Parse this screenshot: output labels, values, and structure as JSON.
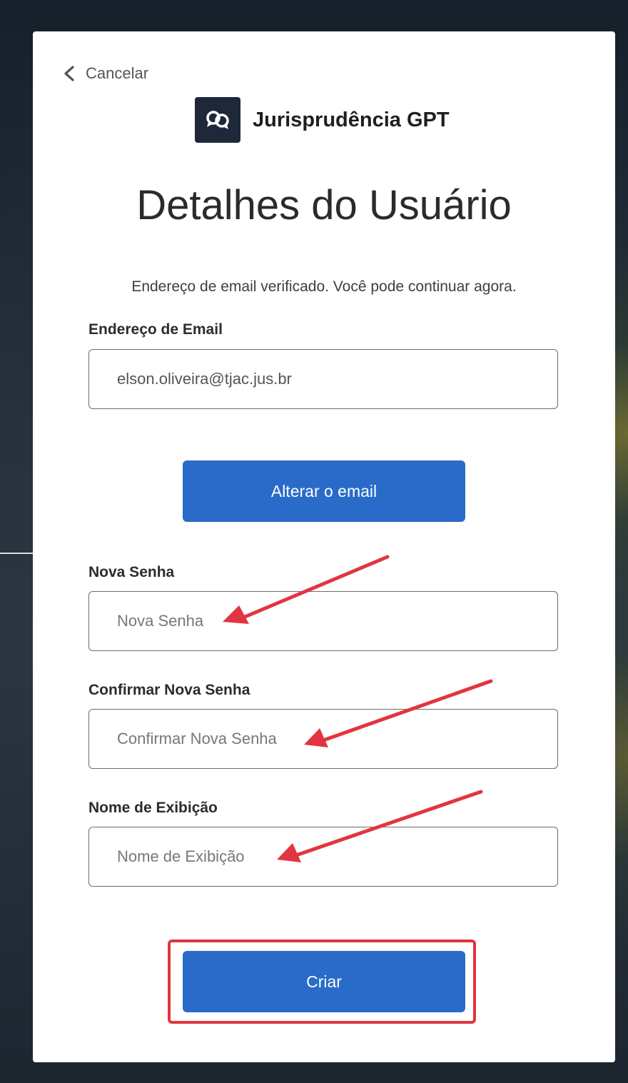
{
  "back": {
    "label": "Cancelar"
  },
  "brand": {
    "name": "Jurisprudência GPT"
  },
  "page": {
    "title": "Detalhes do Usuário",
    "subtitle": "Endereço de email verificado. Você pode continuar agora."
  },
  "form": {
    "email": {
      "label": "Endereço de Email",
      "value": "elson.oliveira@tjac.jus.br"
    },
    "change_email_label": "Alterar o email",
    "new_password": {
      "label": "Nova Senha",
      "placeholder": "Nova Senha"
    },
    "confirm_password": {
      "label": "Confirmar Nova Senha",
      "placeholder": "Confirmar Nova Senha"
    },
    "display_name": {
      "label": "Nome de Exibição",
      "placeholder": "Nome de Exibição"
    },
    "create_label": "Criar"
  },
  "colors": {
    "primary_button": "#2a6bc9",
    "annotation_red": "#e13540",
    "logo_bg": "#1e2838"
  },
  "icons": {
    "back": "chevron-left-icon",
    "logo": "chat-bubbles-icon",
    "annotation": "arrow-icon"
  }
}
